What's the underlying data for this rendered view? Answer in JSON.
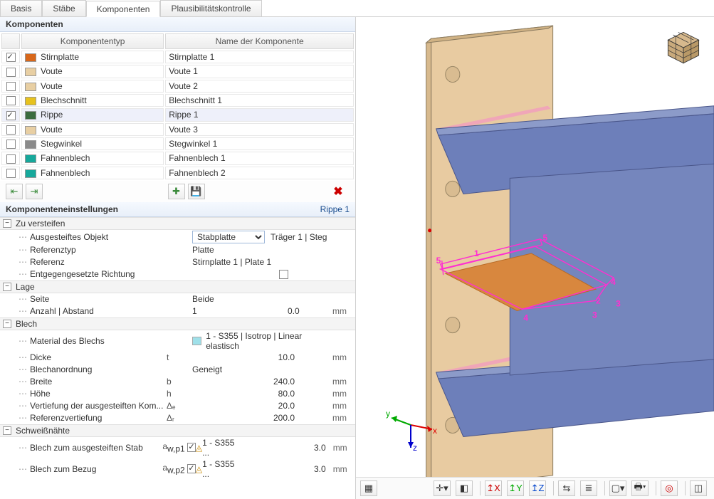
{
  "tabs": [
    "Basis",
    "Stäbe",
    "Komponenten",
    "Plausibilitätskontrolle"
  ],
  "active_tab": 2,
  "components_panel": {
    "title": "Komponenten"
  },
  "comp_headers": {
    "type": "Komponententyp",
    "name": "Name der Komponente"
  },
  "components": [
    {
      "checked": true,
      "color": "#d8671a",
      "type": "Stirnplatte",
      "name": "Stirnplatte 1",
      "sel": false
    },
    {
      "checked": false,
      "color": "#e8cfa3",
      "type": "Voute",
      "name": "Voute 1",
      "sel": false
    },
    {
      "checked": false,
      "color": "#e8cfa3",
      "type": "Voute",
      "name": "Voute 2",
      "sel": false
    },
    {
      "checked": false,
      "color": "#e7c21e",
      "type": "Blechschnitt",
      "name": "Blechschnitt 1",
      "sel": false
    },
    {
      "checked": true,
      "color": "#3b6b3f",
      "type": "Rippe",
      "name": "Rippe 1",
      "sel": true
    },
    {
      "checked": false,
      "color": "#e8cfa3",
      "type": "Voute",
      "name": "Voute 3",
      "sel": false
    },
    {
      "checked": false,
      "color": "#8a8a8a",
      "type": "Stegwinkel",
      "name": "Stegwinkel 1",
      "sel": false
    },
    {
      "checked": false,
      "color": "#16a89b",
      "type": "Fahnenblech",
      "name": "Fahnenblech 1",
      "sel": false
    },
    {
      "checked": false,
      "color": "#16a89b",
      "type": "Fahnenblech",
      "name": "Fahnenblech 2",
      "sel": false
    }
  ],
  "settings_panel": {
    "title": "Komponenteneinstellungen",
    "right": "Rippe 1"
  },
  "groups": {
    "stiffen": {
      "title": "Zu versteifen",
      "rows": [
        {
          "label": "Ausgesteiftes Objekt",
          "sym": "",
          "ctrl": "select",
          "value": "Stabplatte",
          "extra": "Träger 1 | Steg"
        },
        {
          "label": "Referenztyp",
          "sym": "",
          "value": "Platte"
        },
        {
          "label": "Referenz",
          "sym": "",
          "value": "Stirnplatte 1 | Plate 1"
        },
        {
          "label": "Entgegengesetzte Richtung",
          "sym": "",
          "ctrl": "check",
          "checked": false
        }
      ]
    },
    "lage": {
      "title": "Lage",
      "rows": [
        {
          "label": "Seite",
          "sym": "",
          "value": "Beide"
        },
        {
          "label": "Anzahl | Abstand",
          "sym": "",
          "value": "1",
          "num": "0.0",
          "unit": "mm"
        }
      ]
    },
    "blech": {
      "title": "Blech",
      "rows": [
        {
          "label": "Material des Blechs",
          "sym": "",
          "swatch": "#9fe0e9",
          "value": "1 - S355 | Isotrop | Linear elastisch"
        },
        {
          "label": "Dicke",
          "sym": "t",
          "num": "10.0",
          "unit": "mm"
        },
        {
          "label": "Blechanordnung",
          "sym": "",
          "value": "Geneigt"
        },
        {
          "label": "Breite",
          "sym": "b",
          "num": "240.0",
          "unit": "mm"
        },
        {
          "label": "Höhe",
          "sym": "h",
          "num": "80.0",
          "unit": "mm"
        },
        {
          "label": "Vertiefung der ausgesteiften Kom...",
          "sym": "Δₑ",
          "num": "20.0",
          "unit": "mm"
        },
        {
          "label": "Referenzvertiefung",
          "sym": "Δᵣ",
          "num": "200.0",
          "unit": "mm"
        }
      ]
    },
    "welds": {
      "title": "Schweißnähte",
      "rows": [
        {
          "label": "Blech zum ausgesteiften Stab",
          "sym": "a_w,p1",
          "weld": true,
          "mat": "1 - S355 ...",
          "num": "3.0",
          "unit": "mm"
        },
        {
          "label": "Blech zum Bezug",
          "sym": "a_w,p2",
          "weld": true,
          "mat": "1 - S355 ...",
          "num": "3.0",
          "unit": "mm"
        }
      ]
    }
  },
  "viewport": {
    "axes": {
      "x": "x",
      "y": "y",
      "z": "z"
    },
    "node_labels": [
      "1",
      "2",
      "3",
      "4",
      "5",
      "5",
      "4",
      "3"
    ]
  },
  "vt_icons": [
    "layers",
    "axes-dropdown",
    "view",
    "x-view",
    "y-view",
    "z-view",
    "sync",
    "stack",
    "box-dropdown",
    "print-dropdown",
    "target",
    "panel"
  ]
}
